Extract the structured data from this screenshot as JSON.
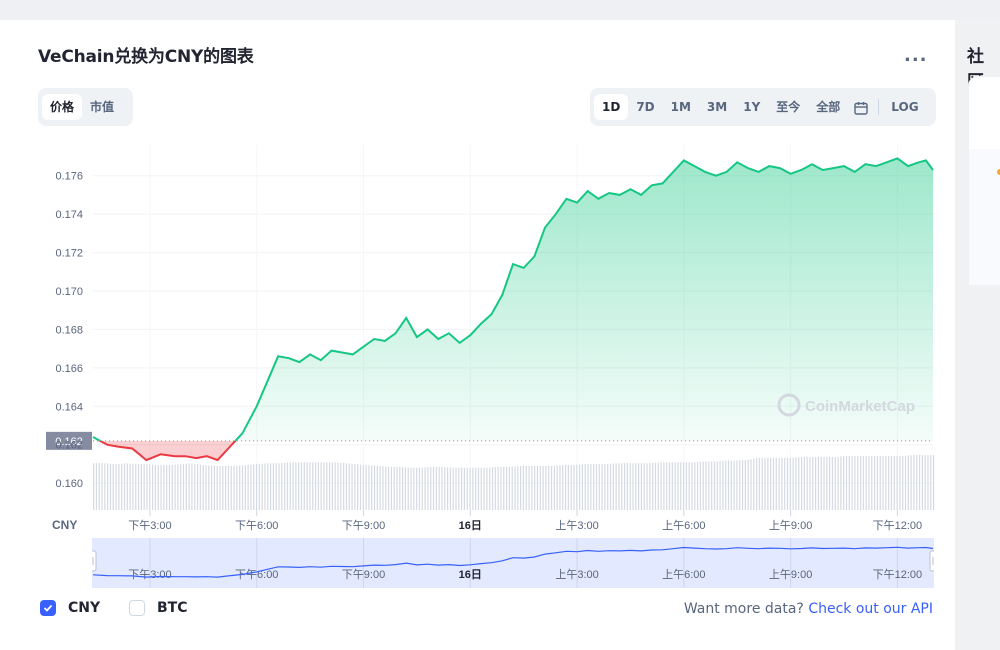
{
  "header": {
    "title": "VeChain兑换为CNY的图表",
    "more_label": "..."
  },
  "type_tabs": [
    {
      "label": "价格",
      "active": true
    },
    {
      "label": "市值",
      "active": false
    }
  ],
  "range_tabs": [
    {
      "label": "1D",
      "active": true
    },
    {
      "label": "7D",
      "active": false
    },
    {
      "label": "1M",
      "active": false
    },
    {
      "label": "3M",
      "active": false
    },
    {
      "label": "1Y",
      "active": false
    },
    {
      "label": "至今",
      "active": false
    },
    {
      "label": "全部",
      "active": false
    }
  ],
  "calendar_icon": "calendar-icon",
  "log_label": "LOG",
  "watermark": "CoinMarketCap",
  "legend": {
    "cny_label": "CNY",
    "cny_checked": true,
    "btc_label": "BTC",
    "btc_checked": false
  },
  "footer": {
    "prompt": "Want more data?",
    "link": "Check out our API"
  },
  "sidebar": {
    "title": "社区"
  },
  "colors": {
    "up": "#16c784",
    "down": "#ea3943",
    "accent": "#3861fb",
    "navigator_fill": "#e3e9ff"
  },
  "chart_data": {
    "type": "area",
    "currency_label": "CNY",
    "y_ticks": [
      "0.176",
      "0.174",
      "0.172",
      "0.170",
      "0.168",
      "0.166",
      "0.164",
      "0.162",
      "0.160"
    ],
    "y_range": [
      0.1586,
      0.1776
    ],
    "x_range_hours": [
      13.4,
      37.0
    ],
    "x_ticks": [
      {
        "label": "下午3:00",
        "hour": 15,
        "bold": false
      },
      {
        "label": "下午6:00",
        "hour": 18,
        "bold": false
      },
      {
        "label": "下午9:00",
        "hour": 21,
        "bold": false
      },
      {
        "label": "16日",
        "hour": 24,
        "bold": true
      },
      {
        "label": "上午3:00",
        "hour": 27,
        "bold": false
      },
      {
        "label": "上午6:00",
        "hour": 30,
        "bold": false
      },
      {
        "label": "上午9:00",
        "hour": 33,
        "bold": false
      },
      {
        "label": "下午12:00",
        "hour": 36,
        "bold": false
      }
    ],
    "open_price": 0.1622,
    "open_price_label": "0.162",
    "series": [
      {
        "x_hours": [
          13.4,
          13.8,
          14.1,
          14.5,
          14.9,
          15.3,
          15.7,
          16.0,
          16.3,
          16.6,
          16.9,
          17.2,
          17.6,
          18.0,
          18.3,
          18.6,
          18.9,
          19.2,
          19.5,
          19.8,
          20.1,
          20.4,
          20.7,
          21.0,
          21.3,
          21.6,
          21.9,
          22.2,
          22.5,
          22.8,
          23.1,
          23.4,
          23.7,
          24.0,
          24.3,
          24.6,
          24.9,
          25.2,
          25.5,
          25.8,
          26.1,
          26.4,
          26.7,
          27.0,
          27.3,
          27.6,
          27.9,
          28.2,
          28.5,
          28.8,
          29.1,
          29.4,
          29.7,
          30.0,
          30.3,
          30.6,
          30.9,
          31.2,
          31.5,
          31.8,
          32.1,
          32.4,
          32.7,
          33.0,
          33.3,
          33.6,
          33.9,
          34.2,
          34.5,
          34.8,
          35.1,
          35.4,
          35.7,
          36.0,
          36.3,
          36.6,
          36.8,
          37.0
        ],
        "values": [
          0.1624,
          0.162,
          0.1619,
          0.1618,
          0.1612,
          0.1615,
          0.1614,
          0.1614,
          0.1613,
          0.1614,
          0.1612,
          0.1618,
          0.1626,
          0.164,
          0.1653,
          0.1666,
          0.1665,
          0.1663,
          0.1667,
          0.1664,
          0.1669,
          0.1668,
          0.1667,
          0.1671,
          0.1675,
          0.1674,
          0.1678,
          0.1686,
          0.1676,
          0.168,
          0.1675,
          0.1678,
          0.1673,
          0.1677,
          0.1683,
          0.1688,
          0.1698,
          0.1714,
          0.1712,
          0.1718,
          0.1733,
          0.174,
          0.1748,
          0.1746,
          0.1752,
          0.1748,
          0.1751,
          0.175,
          0.1753,
          0.175,
          0.1755,
          0.1756,
          0.1762,
          0.1768,
          0.1765,
          0.1762,
          0.176,
          0.1762,
          0.1767,
          0.1764,
          0.1762,
          0.1765,
          0.1764,
          0.1761,
          0.1763,
          0.1766,
          0.1763,
          0.1764,
          0.1765,
          0.1762,
          0.1766,
          0.1765,
          0.1767,
          0.1769,
          0.1765,
          0.1767,
          0.1768,
          0.1763
        ]
      }
    ],
    "volume": [
      0.52,
      0.52,
      0.51,
      0.52,
      0.51,
      0.51,
      0.5,
      0.5,
      0.51,
      0.52,
      0.5,
      0.49,
      0.49,
      0.49,
      0.5,
      0.51,
      0.52,
      0.52,
      0.53,
      0.53,
      0.53,
      0.53,
      0.53,
      0.52,
      0.51,
      0.5,
      0.49,
      0.48,
      0.48,
      0.47,
      0.47,
      0.48,
      0.48,
      0.47,
      0.47,
      0.47,
      0.47,
      0.48,
      0.48,
      0.49,
      0.49,
      0.49,
      0.49,
      0.5,
      0.5,
      0.51,
      0.51,
      0.51,
      0.52,
      0.52,
      0.52,
      0.52,
      0.53,
      0.53,
      0.53,
      0.53,
      0.54,
      0.54,
      0.55,
      0.55,
      0.56,
      0.58,
      0.58,
      0.58,
      0.58,
      0.59,
      0.59,
      0.59,
      0.59,
      0.6,
      0.6,
      0.6,
      0.6,
      0.6,
      0.6,
      0.61,
      0.61,
      0.61
    ]
  }
}
